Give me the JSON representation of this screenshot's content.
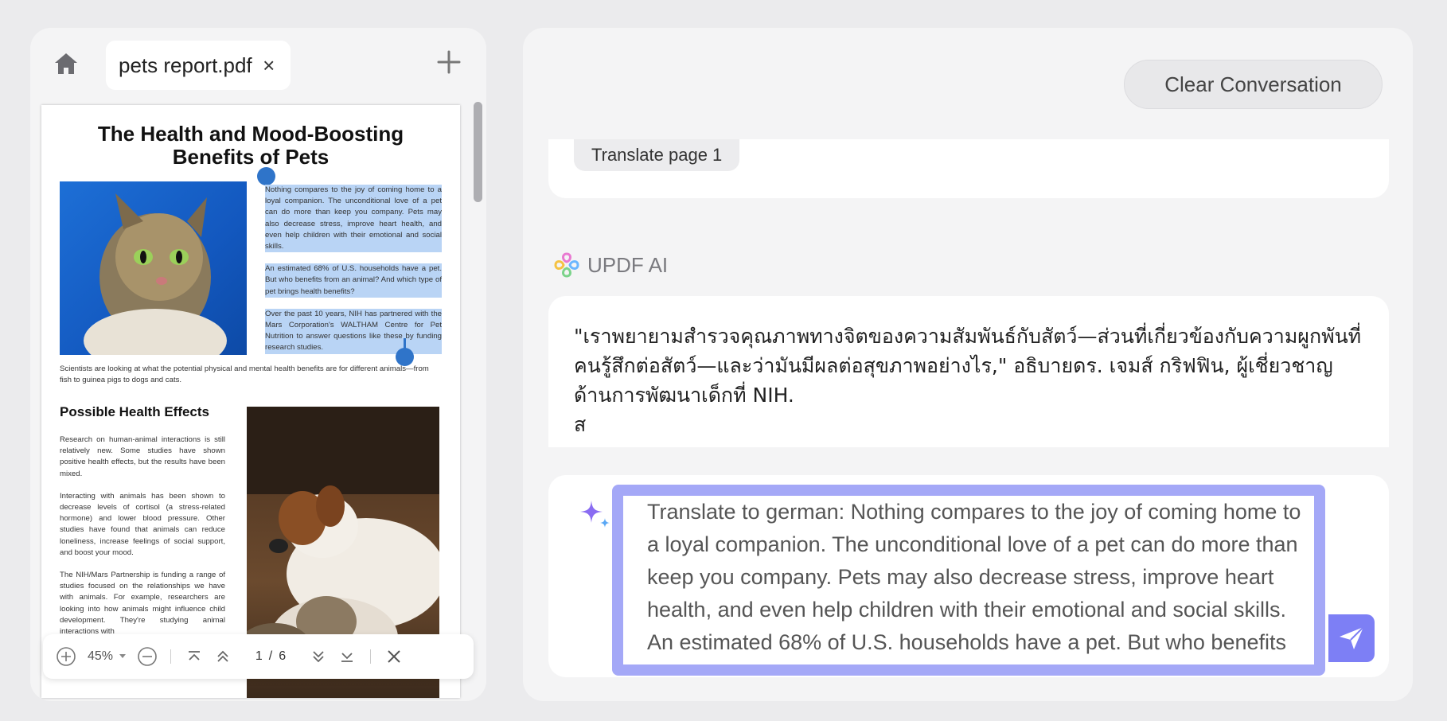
{
  "left": {
    "tab_label": "pets report.pdf",
    "tab_close": "×",
    "toolbar": {
      "zoom": "45%",
      "page_current": "1",
      "page_sep": "/",
      "page_total": "6"
    }
  },
  "doc": {
    "title_line1": "The Health and Mood-Boosting",
    "title_line2": "Benefits of Pets",
    "para1": "Nothing compares to the joy of coming home to a loyal companion. The unconditional love of a pet can do more than keep you company. Pets may also decrease stress, improve heart health, and even help children with their emotional and social skills.",
    "para2": "An estimated 68% of U.S. households have a pet. But who benefits from an animal? And which type of pet brings health benefits?",
    "para3": "Over the past 10 years, NIH has partnered with the Mars Corporation's WALTHAM Centre for Pet Nutrition to answer questions like these by funding research studies.",
    "caption": "Scientists are looking at what the potential physical and mental health benefits are for different animals—from fish to guinea pigs to dogs and cats.",
    "heading2": "Possible Health Effects",
    "col1": "Research on human-animal interactions is still relatively new. Some studies have shown positive health effects, but the results have been mixed.",
    "col2": "Interacting with animals has been shown to decrease levels of cortisol (a stress-related hormone) and lower blood pressure. Other studies have found that animals can reduce loneliness, increase feelings of social support, and boost your mood.",
    "col3": "The NIH/Mars Partnership is funding a range of studies focused on the relationships we have with animals. For example, researchers are looking into how animals might influence child development. They're studying animal interactions with"
  },
  "right": {
    "clear_label": "Clear Conversation",
    "chip_label": "Translate page 1",
    "ai_name": "UPDF AI",
    "ai_message": "\"เราพยายามสำรวจคุณภาพทางจิตของความสัมพันธ์กับสัตว์—ส่วนที่เกี่ยวข้องกับความผูกพันที่คนรู้สึกต่อสัตว์—และว่ามันมีผลต่อสุขภาพอย่างไร,\" อธิบายดร. เจมส์ กริฟฟิน, ผู้เชี่ยวชาญด้านการพัฒนาเด็กที่ NIH.\nส",
    "input_value": "Translate to german: Nothing compares to the joy of coming home to a loyal companion. The unconditional love of a pet can do more than keep you company. Pets may also decrease stress, improve heart health, and even help children with their emotional and social skills. An estimated 68% of U.S. households have a pet. But who benefits from an animal? And which type of pet brings health benefits?"
  },
  "colors": {
    "accent": "#7d7ff5",
    "input_frame": "#a4a8f7",
    "selection": "#b9d4f5",
    "handle": "#2f74c9"
  }
}
